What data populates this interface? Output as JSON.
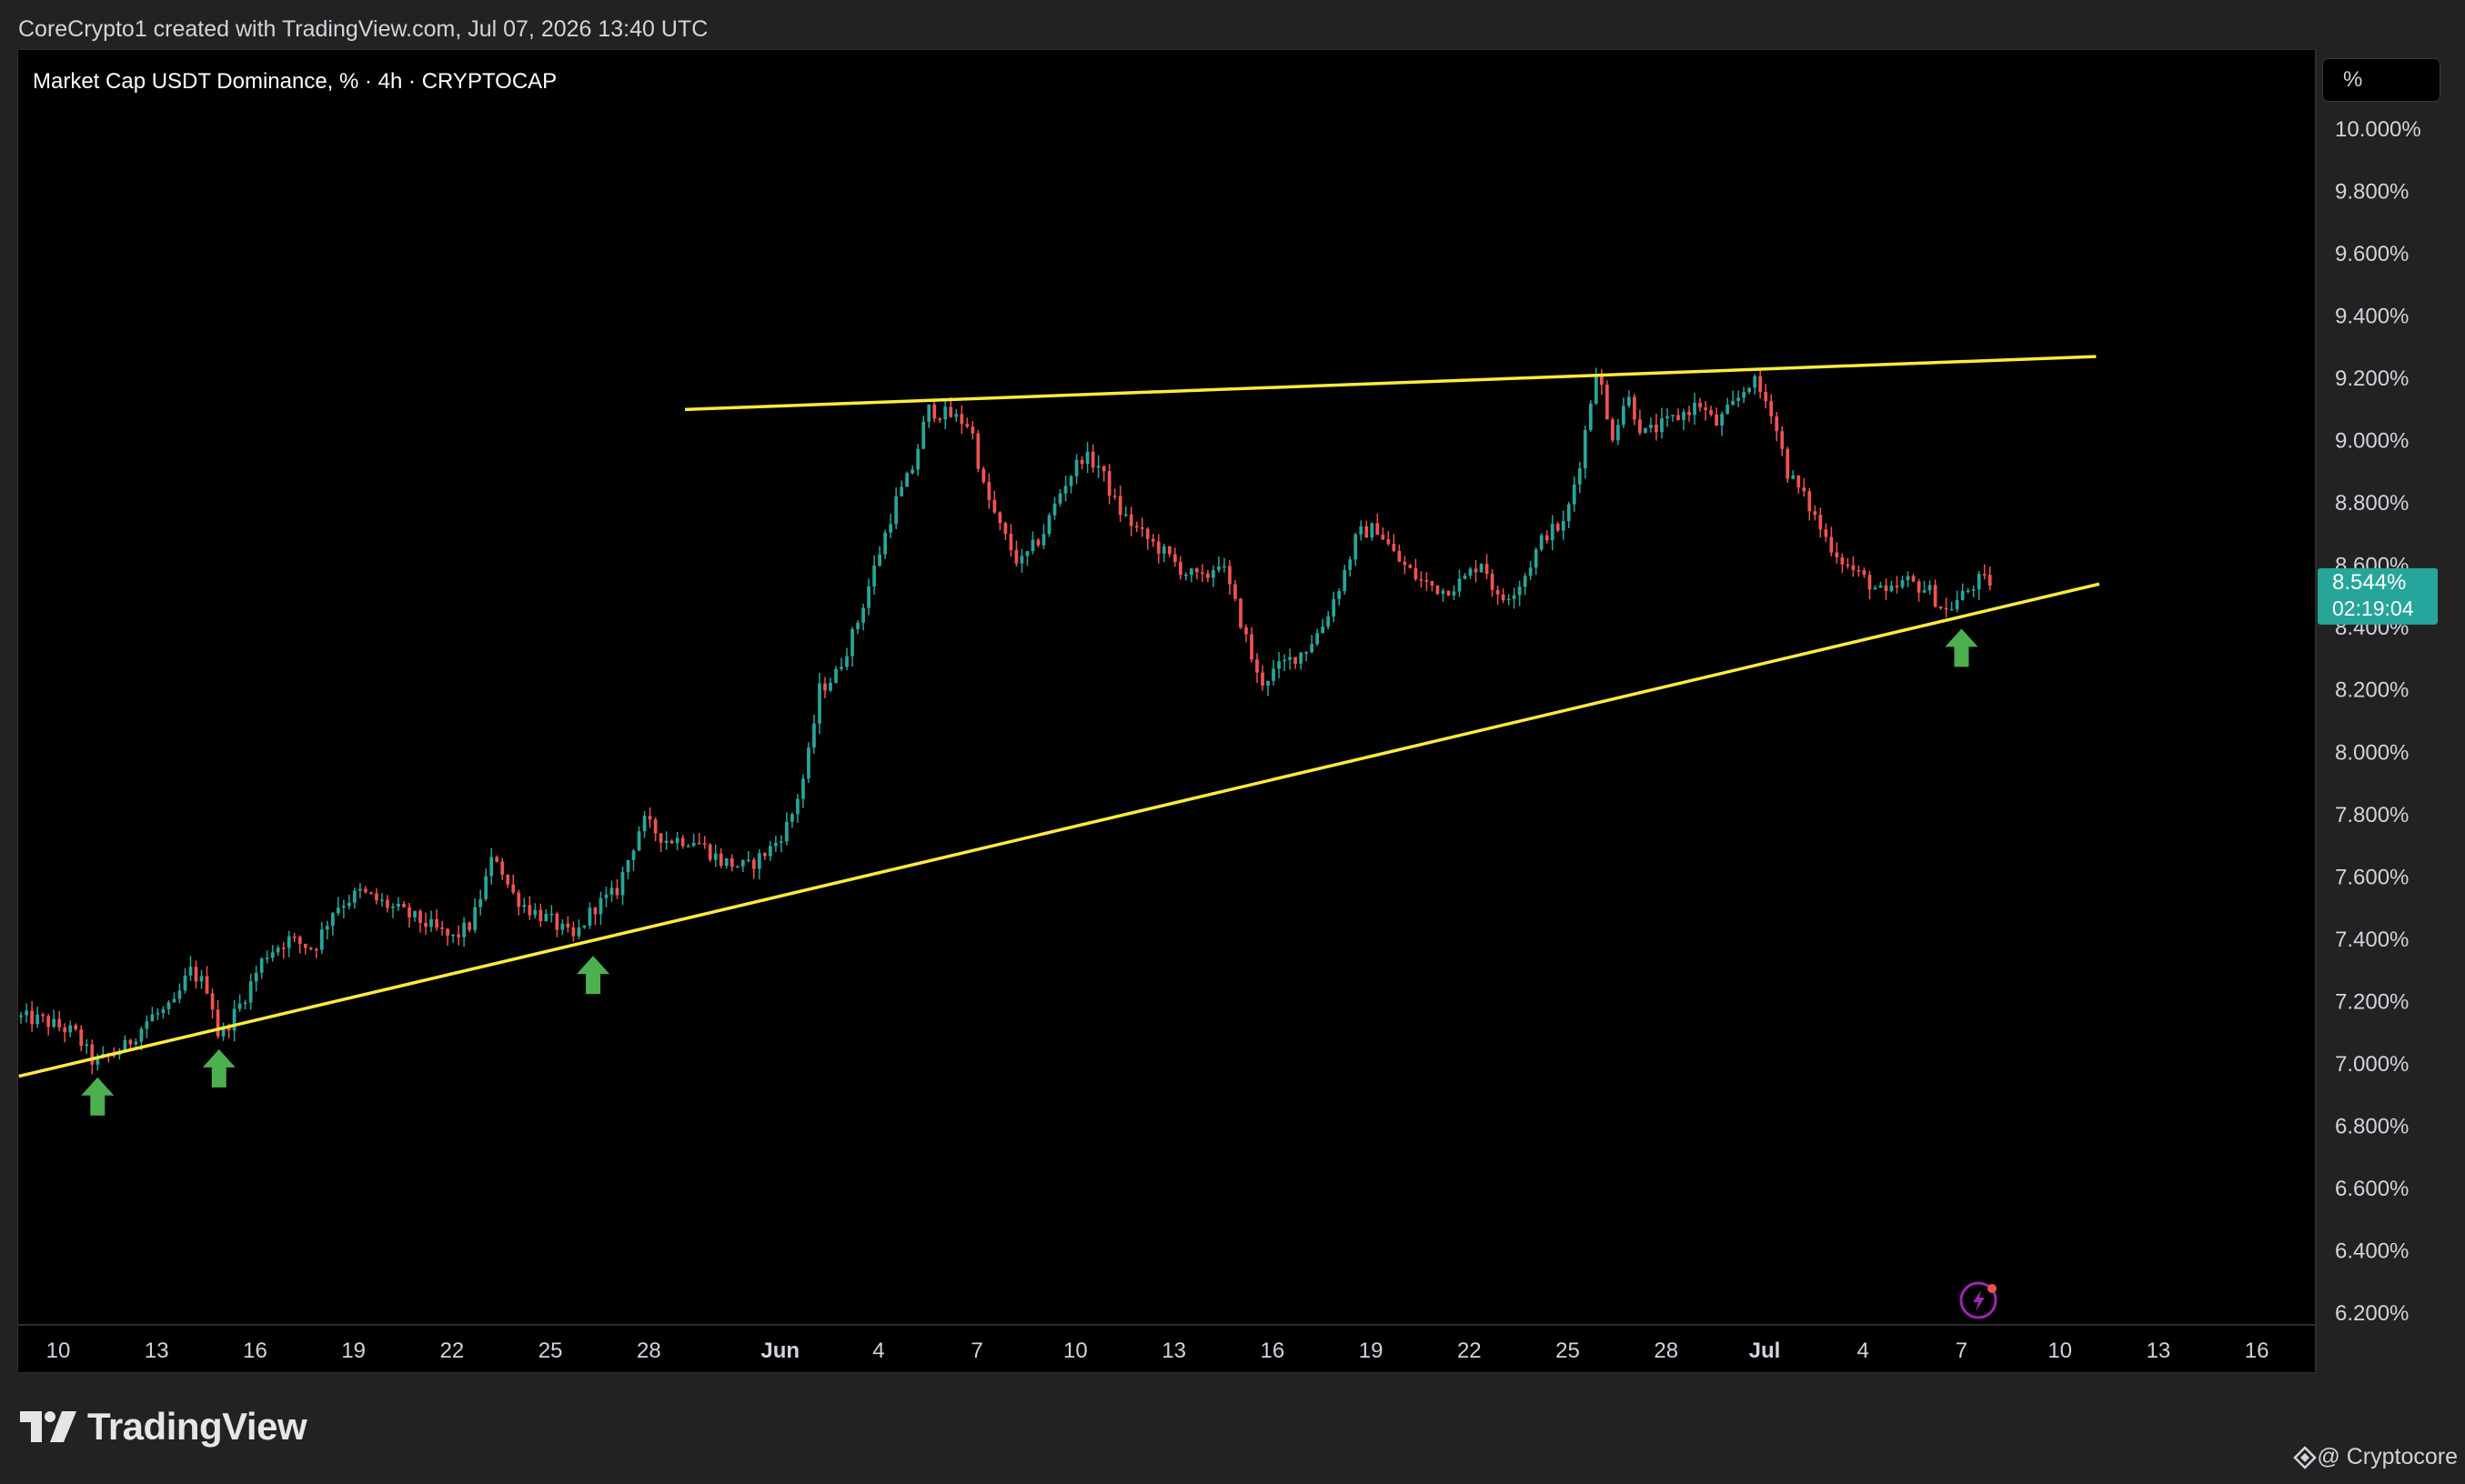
{
  "header": {
    "caption": "CoreCrypto1 created with TradingView.com, Jul 07, 2026 13:40 UTC",
    "symbol_title": "Market Cap USDT Dominance, % · 4h · CRYPTOCAP",
    "scale_button": "%"
  },
  "footer": {
    "logo_text": "TradingView",
    "credit": "@ Cryptocore"
  },
  "icons": [
    "tradingview-logo-icon",
    "lightning-icon",
    "arrow-up-icon",
    "credit-icon"
  ],
  "colors": {
    "up": "#26a69a",
    "down": "#ef5350",
    "trendline": "#ffeb3b",
    "marker": "#4caf50",
    "price_label": "#26a69a"
  },
  "chart_data": {
    "type": "candlestick",
    "title": "Market Cap USDT Dominance, % · 4h · CRYPTOCAP",
    "y_unit": "%",
    "ylim": [
      6.2,
      10.0
    ],
    "y_ticks": [
      "10.000%",
      "9.800%",
      "9.600%",
      "9.400%",
      "9.200%",
      "9.000%",
      "8.800%",
      "8.600%",
      "8.400%",
      "8.200%",
      "8.000%",
      "7.800%",
      "7.600%",
      "7.400%",
      "7.200%",
      "7.000%",
      "6.800%",
      "6.600%",
      "6.400%",
      "6.200%"
    ],
    "x_ticks": [
      {
        "label": "10",
        "day": 10
      },
      {
        "label": "13",
        "day": 13
      },
      {
        "label": "16",
        "day": 16
      },
      {
        "label": "19",
        "day": 19
      },
      {
        "label": "22",
        "day": 22
      },
      {
        "label": "25",
        "day": 25
      },
      {
        "label": "28",
        "day": 28
      },
      {
        "label": "Jun",
        "day": 32,
        "month": true
      },
      {
        "label": "4",
        "day": 35
      },
      {
        "label": "7",
        "day": 38
      },
      {
        "label": "10",
        "day": 41
      },
      {
        "label": "13",
        "day": 44
      },
      {
        "label": "16",
        "day": 47
      },
      {
        "label": "19",
        "day": 50
      },
      {
        "label": "22",
        "day": 53
      },
      {
        "label": "25",
        "day": 56
      },
      {
        "label": "28",
        "day": 59
      },
      {
        "label": "Jul",
        "day": 62,
        "month": true
      },
      {
        "label": "4",
        "day": 65
      },
      {
        "label": "7",
        "day": 68
      },
      {
        "label": "10",
        "day": 71
      },
      {
        "label": "13",
        "day": 74
      },
      {
        "label": "16",
        "day": 77
      }
    ],
    "price_path": [
      [
        8.7,
        7.15
      ],
      [
        9.5,
        7.14
      ],
      [
        10.5,
        7.1
      ],
      [
        11.1,
        7.0
      ],
      [
        12.0,
        7.05
      ],
      [
        12.8,
        7.15
      ],
      [
        13.5,
        7.18
      ],
      [
        14.0,
        7.3
      ],
      [
        14.6,
        7.24
      ],
      [
        14.9,
        7.08
      ],
      [
        15.6,
        7.2
      ],
      [
        16.3,
        7.35
      ],
      [
        17.0,
        7.4
      ],
      [
        17.8,
        7.37
      ],
      [
        18.4,
        7.5
      ],
      [
        19.2,
        7.55
      ],
      [
        20.2,
        7.5
      ],
      [
        21.2,
        7.45
      ],
      [
        22.0,
        7.4
      ],
      [
        22.6,
        7.45
      ],
      [
        23.3,
        7.68
      ],
      [
        23.8,
        7.55
      ],
      [
        24.3,
        7.5
      ],
      [
        25.0,
        7.46
      ],
      [
        25.7,
        7.4
      ],
      [
        26.3,
        7.5
      ],
      [
        27.0,
        7.55
      ],
      [
        27.8,
        7.78
      ],
      [
        28.5,
        7.72
      ],
      [
        29.4,
        7.72
      ],
      [
        30.2,
        7.65
      ],
      [
        31.0,
        7.63
      ],
      [
        31.8,
        7.7
      ],
      [
        32.3,
        7.78
      ],
      [
        32.8,
        7.95
      ],
      [
        33.2,
        8.2
      ],
      [
        33.7,
        8.25
      ],
      [
        34.3,
        8.4
      ],
      [
        34.9,
        8.6
      ],
      [
        35.5,
        8.8
      ],
      [
        36.0,
        8.9
      ],
      [
        36.5,
        9.1
      ],
      [
        37.2,
        9.08
      ],
      [
        37.8,
        9.05
      ],
      [
        38.2,
        8.85
      ],
      [
        38.7,
        8.72
      ],
      [
        39.3,
        8.6
      ],
      [
        40.0,
        8.7
      ],
      [
        40.6,
        8.85
      ],
      [
        41.2,
        8.95
      ],
      [
        41.7,
        8.92
      ],
      [
        42.3,
        8.78
      ],
      [
        43.0,
        8.7
      ],
      [
        43.6,
        8.65
      ],
      [
        44.3,
        8.58
      ],
      [
        44.9,
        8.55
      ],
      [
        45.4,
        8.62
      ],
      [
        46.1,
        8.4
      ],
      [
        46.6,
        8.22
      ],
      [
        47.3,
        8.28
      ],
      [
        48.0,
        8.33
      ],
      [
        48.5,
        8.4
      ],
      [
        49.1,
        8.55
      ],
      [
        49.6,
        8.7
      ],
      [
        50.2,
        8.72
      ],
      [
        50.8,
        8.62
      ],
      [
        51.5,
        8.55
      ],
      [
        52.2,
        8.52
      ],
      [
        52.8,
        8.55
      ],
      [
        53.4,
        8.62
      ],
      [
        53.9,
        8.48
      ],
      [
        54.6,
        8.55
      ],
      [
        55.3,
        8.7
      ],
      [
        55.9,
        8.73
      ],
      [
        56.4,
        8.95
      ],
      [
        56.9,
        9.25
      ],
      [
        57.3,
        9.0
      ],
      [
        57.8,
        9.15
      ],
      [
        58.3,
        9.02
      ],
      [
        58.9,
        9.05
      ],
      [
        59.4,
        9.08
      ],
      [
        60.0,
        9.12
      ],
      [
        60.5,
        9.05
      ],
      [
        61.1,
        9.12
      ],
      [
        61.6,
        9.2
      ],
      [
        62.2,
        9.1
      ],
      [
        62.7,
        8.9
      ],
      [
        63.3,
        8.8
      ],
      [
        63.9,
        8.68
      ],
      [
        64.5,
        8.6
      ],
      [
        65.1,
        8.55
      ],
      [
        65.7,
        8.5
      ],
      [
        66.3,
        8.55
      ],
      [
        67.0,
        8.52
      ],
      [
        67.5,
        8.45
      ],
      [
        68.0,
        8.5
      ],
      [
        68.5,
        8.55
      ],
      [
        69.0,
        8.544
      ]
    ],
    "trendlines": [
      {
        "name": "resistance",
        "from": [
          29.1,
          9.1
        ],
        "to": [
          72.1,
          9.27
        ]
      },
      {
        "name": "support",
        "from": [
          8.8,
          6.96
        ],
        "to": [
          72.2,
          8.54
        ]
      }
    ],
    "bounce_markers": [
      {
        "day": 11.2,
        "price": 6.98
      },
      {
        "day": 14.9,
        "price": 7.07
      },
      {
        "day": 26.3,
        "price": 7.37
      },
      {
        "day": 68.0,
        "price": 8.42
      }
    ],
    "last_price": {
      "value": 8.544,
      "label": "8.544%",
      "countdown": "02:19:04"
    }
  }
}
